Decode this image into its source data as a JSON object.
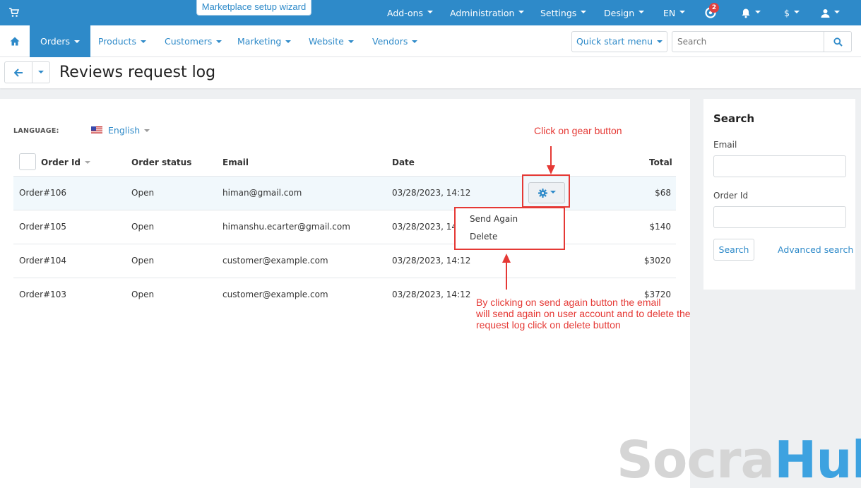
{
  "topbar": {
    "wizard_label": "Marketplace setup wizard",
    "items": [
      "Add-ons",
      "Administration",
      "Settings",
      "Design",
      "EN"
    ],
    "notification_count": "2",
    "currency": "$"
  },
  "mainnav": {
    "items": [
      "Orders",
      "Products",
      "Customers",
      "Marketing",
      "Website",
      "Vendors"
    ],
    "quick_start": "Quick start menu",
    "search_placeholder": "Search"
  },
  "page": {
    "title": "Reviews request log"
  },
  "language": {
    "label": "LANGUAGE:",
    "value": "English"
  },
  "table": {
    "headers": [
      "Order Id",
      "Order status",
      "Email",
      "Date",
      "Total"
    ],
    "rows": [
      {
        "order_id": "Order#106",
        "status": "Open",
        "email": "himan@gmail.com",
        "date": "03/28/2023, 14:12",
        "total": "$68"
      },
      {
        "order_id": "Order#105",
        "status": "Open",
        "email": "himanshu.ecarter@gmail.com",
        "date": "03/28/2023, 14",
        "total": "$140"
      },
      {
        "order_id": "Order#104",
        "status": "Open",
        "email": "customer@example.com",
        "date": "03/28/2023, 14:12",
        "total": "$3020"
      },
      {
        "order_id": "Order#103",
        "status": "Open",
        "email": "customer@example.com",
        "date": "03/28/2023, 14:12",
        "total": "$3720"
      }
    ]
  },
  "dropdown": {
    "send_again": "Send Again",
    "delete": "Delete"
  },
  "annotations": {
    "gear": "Click on gear button",
    "line1": "By clicking on send again button the email",
    "line2": "will send again on user account and to delete the",
    "line3": "request log click on delete button"
  },
  "sidebar": {
    "title": "Search",
    "email_label": "Email",
    "order_id_label": "Order Id",
    "search_button": "Search",
    "advanced": "Advanced search"
  },
  "watermark": {
    "part1": "Socra",
    "part2": "Hub"
  },
  "colors": {
    "primary": "#2e8ac9",
    "annotation": "#e53935"
  }
}
